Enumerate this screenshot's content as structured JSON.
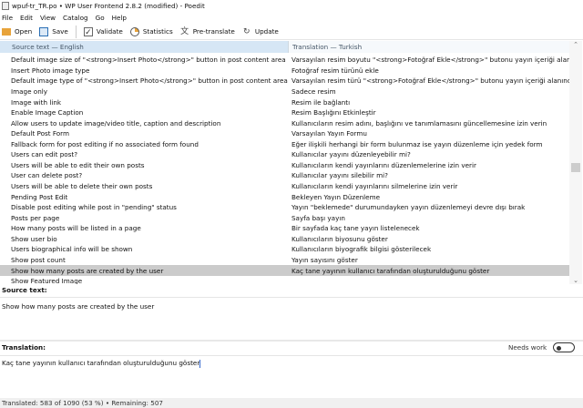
{
  "window": {
    "title": "wpuf-tr_TR.po • WP User Frontend 2.8.2 (modified) - Poedit"
  },
  "menu": [
    "File",
    "Edit",
    "View",
    "Catalog",
    "Go",
    "Help"
  ],
  "toolbar": {
    "open": "Open",
    "save": "Save",
    "validate": "Validate",
    "statistics": "Statistics",
    "pretranslate": "Pre-translate",
    "update": "Update"
  },
  "list": {
    "source_header": "Source text — English",
    "translation_header": "Translation — Turkish",
    "selected_index": 20,
    "rows": [
      [
        "Default image size of \"<strong>Insert Photo</strong>\" button in post content area",
        "Varsayılan resim boyutu \"<strong>Fotoğraf Ekle</strong>\" butonu yayın içeriği alanındadır"
      ],
      [
        "Insert Photo image type",
        "Fotoğraf resim türünü ekle"
      ],
      [
        "Default image type of \"<strong>Insert Photo</strong>\" button in post content area",
        "Varsayılan resim türü \"<strong>Fotoğraf Ekle</strong>\" butonu yayın içeriği alanındadır"
      ],
      [
        "Image only",
        "Sadece resim"
      ],
      [
        "Image with link",
        "Resim ile bağlantı"
      ],
      [
        "Enable Image Caption",
        "Resim Başlığını Etkinleştir"
      ],
      [
        "Allow users to update image/video title, caption and description",
        "Kullanıcıların resim adını, başlığını ve tanımlamasını güncellemesine izin verin"
      ],
      [
        "Default Post Form",
        "Varsayılan Yayın Formu"
      ],
      [
        "Fallback form for post editing if no associated form found",
        "Eğer ilişkili herhangi bir form bulunmaz ise yayın düzenleme için yedek form"
      ],
      [
        "Users can edit post?",
        "Kullanıcılar yayını düzenleyebilir mi?"
      ],
      [
        "Users will be able to edit their own posts",
        "Kullanıcıların kendi yayınlarını düzenlemelerine izin verir"
      ],
      [
        "User can delete post?",
        "Kullanıcılar yayını silebilir mi?"
      ],
      [
        "Users will be able to delete their own posts",
        "Kullanıcıların kendi yayınlarını silmelerine izin verir"
      ],
      [
        "Pending Post Edit",
        "Bekleyen Yayın Düzenleme"
      ],
      [
        "Disable post editing while post in \"pending\" status",
        "Yayın \"beklemede\" durumundayken yayın düzenlemeyi devre dışı bırak"
      ],
      [
        "Posts per page",
        "Sayfa başı yayın"
      ],
      [
        "How many posts will be listed in a page",
        "Bir sayfada  kaç tane yayın listelenecek"
      ],
      [
        "Show user bio",
        "Kullanıcıların biyosunu göster"
      ],
      [
        "Users biographical info will be shown",
        "Kullanıcıların biyografik bilgisi gösterilecek"
      ],
      [
        "Show post count",
        "Yayın sayısını göster"
      ],
      [
        "Show how many posts are created by the user",
        "Kaç tane yayının kullanıcı tarafından oluşturulduğunu göster"
      ],
      [
        "Show Featured Image",
        ""
      ]
    ]
  },
  "editor": {
    "source_label": "Source text:",
    "source_text": "Show how many posts are created by the user",
    "translation_label": "Translation:",
    "needs_work": "Needs work",
    "needs_work_on": false,
    "translation_text": "Kaç tane yayının kullanıcı tarafından oluşturulduğunu göster"
  },
  "status": "Translated: 583 of 1090 (53 %)  •  Remaining: 507"
}
